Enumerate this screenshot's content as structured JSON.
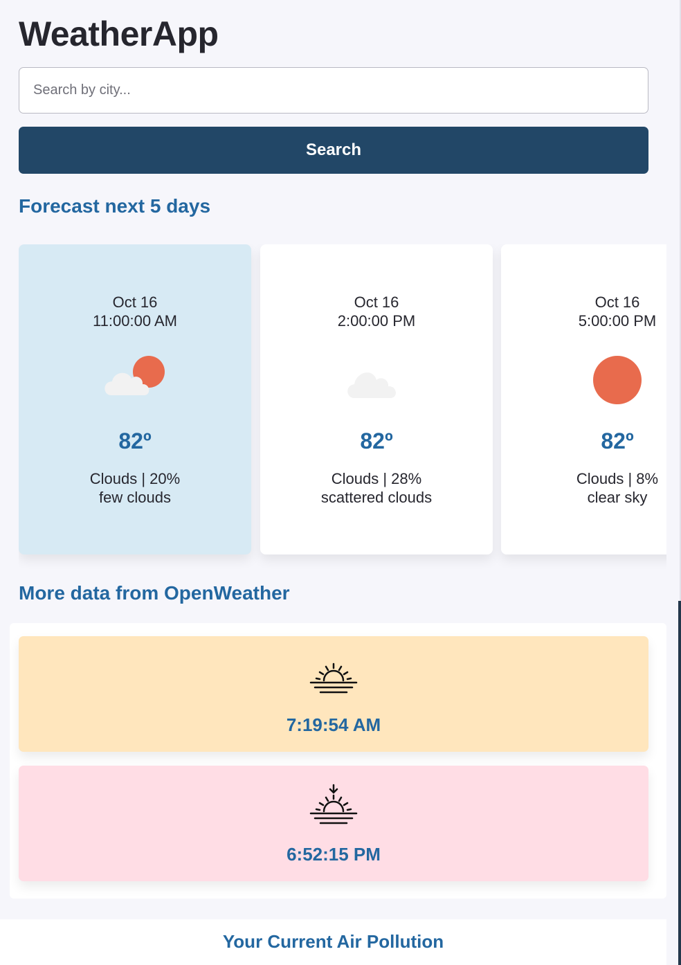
{
  "app": {
    "title": "WeatherApp"
  },
  "search": {
    "placeholder": "Search by city...",
    "value": "",
    "button_label": "Search"
  },
  "forecast": {
    "heading": "Forecast next 5 days",
    "cards": [
      {
        "date": "Oct 16",
        "time": "11:00:00 AM",
        "icon": "cloud-sun-icon",
        "temp": "82º",
        "summary": "Clouds | 20%",
        "description": "few clouds",
        "selected": true
      },
      {
        "date": "Oct 16",
        "time": "2:00:00 PM",
        "icon": "cloud-icon",
        "temp": "82º",
        "summary": "Clouds | 28%",
        "description": "scattered clouds",
        "selected": false
      },
      {
        "date": "Oct 16",
        "time": "5:00:00 PM",
        "icon": "sun-icon",
        "temp": "82º",
        "summary": "Clouds | 8%",
        "description": "clear sky",
        "selected": false
      }
    ]
  },
  "more": {
    "heading": "More data from OpenWeather",
    "sunrise": {
      "icon": "sunrise-icon",
      "time": "7:19:54 AM"
    },
    "sunset": {
      "icon": "sunset-icon",
      "time": "6:52:15 PM"
    }
  },
  "pollution": {
    "heading": "Your Current Air Pollution"
  },
  "colors": {
    "background": "#f6f6fb",
    "title": "#26262e",
    "accent_blue": "#2367a0",
    "button": "#224767",
    "selected_card": "#d7eaf4",
    "sunrise_card": "#ffe6bd",
    "sunset_card": "#ffdde5",
    "sun": "#e86b4d",
    "cloud": "#f2f2f2"
  }
}
